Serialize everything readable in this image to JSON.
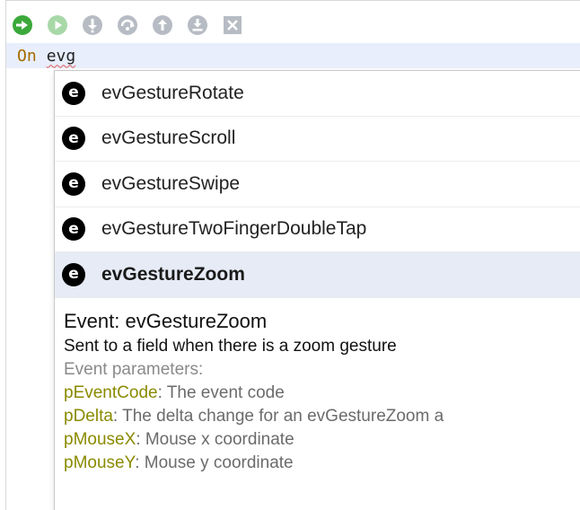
{
  "toolbar": {
    "buttons": [
      {
        "name": "run-icon",
        "color": "#3aa93a"
      },
      {
        "name": "play-icon",
        "color": "#a8d8a8"
      },
      {
        "name": "step-into-icon",
        "color": "#b7bcc4"
      },
      {
        "name": "step-over-icon",
        "color": "#b7bcc4"
      },
      {
        "name": "step-out-icon",
        "color": "#b7bcc4"
      },
      {
        "name": "download-icon",
        "color": "#b7bcc4"
      },
      {
        "name": "stop-icon",
        "color": "#b7bcc4"
      }
    ]
  },
  "editor": {
    "keyword": "On",
    "typed_text": "evg"
  },
  "completions": {
    "icon_letter": "e",
    "items": [
      {
        "label": "evGestureRotate",
        "selected": false
      },
      {
        "label": "evGestureScroll",
        "selected": false
      },
      {
        "label": "evGestureSwipe",
        "selected": false
      },
      {
        "label": "evGestureTwoFingerDoubleTap",
        "selected": false
      },
      {
        "label": "evGestureZoom",
        "selected": true
      }
    ]
  },
  "description": {
    "title": "Event: evGestureZoom",
    "summary": "Sent to a field when there is a zoom gesture",
    "params_heading": "Event parameters:",
    "params": [
      {
        "name": "pEventCode",
        "desc": ": The event code"
      },
      {
        "name": "pDelta",
        "desc": ": The delta change for an evGestureZoom a"
      },
      {
        "name": "pMouseX",
        "desc": ": Mouse x coordinate"
      },
      {
        "name": "pMouseY",
        "desc": ": Mouse y coordinate"
      }
    ]
  },
  "colors": {
    "keyword": "#a36a00",
    "param_name": "#8a8a00",
    "selection": "#e6ebf5",
    "code_line_highlight": "#e8eefb"
  }
}
